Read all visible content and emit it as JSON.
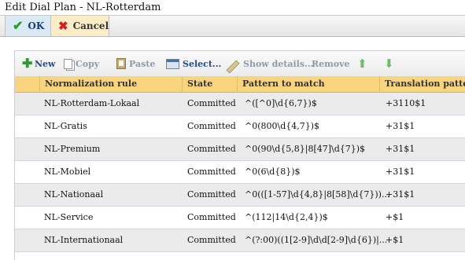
{
  "window": {
    "title": "Edit Dial Plan - NL-Rotterdam"
  },
  "actions": {
    "ok_label": "OK",
    "cancel_label": "Cancel"
  },
  "toolbar": {
    "new_label": "New",
    "copy_label": "Copy",
    "paste_label": "Paste",
    "select_label": "Select...",
    "show_details_label": "Show details...",
    "remove_label": "Remove"
  },
  "grid": {
    "columns": [
      "Normalization rule",
      "State",
      "Pattern to match",
      "Translation pattern"
    ],
    "rows": [
      {
        "rule": "NL-Rotterdam-Lokaal",
        "state": "Committed",
        "pattern": "^([^0]\\d{6,7})$",
        "translation": "+3110$1"
      },
      {
        "rule": "NL-Gratis",
        "state": "Committed",
        "pattern": "^0(800\\d{4,7})$",
        "translation": "+31$1"
      },
      {
        "rule": "NL-Premium",
        "state": "Committed",
        "pattern": "^0(90\\d{5,8}|8[47]\\d{7})$",
        "translation": "+31$1"
      },
      {
        "rule": "NL-Mobiel",
        "state": "Committed",
        "pattern": "^0(6\\d{8})$",
        "translation": "+31$1"
      },
      {
        "rule": "NL-Nationaal",
        "state": "Committed",
        "pattern": "^0(([1-57]\\d{4,8}|8[58]\\d{7}))...",
        "translation": "+31$1"
      },
      {
        "rule": "NL-Service",
        "state": "Committed",
        "pattern": "^(112|14\\d{2,4})$",
        "translation": "+$1"
      },
      {
        "rule": "NL-Internationaal",
        "state": "Committed",
        "pattern": "^(?:00)((1[2-9]\\d\\d[2-9]\\d{6})|...",
        "translation": "+$1"
      }
    ]
  },
  "colors": {
    "header_bg": "#f7d47d",
    "ok_bg": "#dbe9f5",
    "cancel_bg": "#fbeec7",
    "row_alt": "#ebebeb",
    "enabled_text": "#1d4f8c",
    "disabled_text": "#8e9aab"
  },
  "icons": [
    "check-icon",
    "x-icon",
    "plus-icon",
    "copy-icon",
    "paste-icon",
    "select-icon",
    "pencil-icon",
    "arrow-up-icon",
    "arrow-down-icon"
  ]
}
